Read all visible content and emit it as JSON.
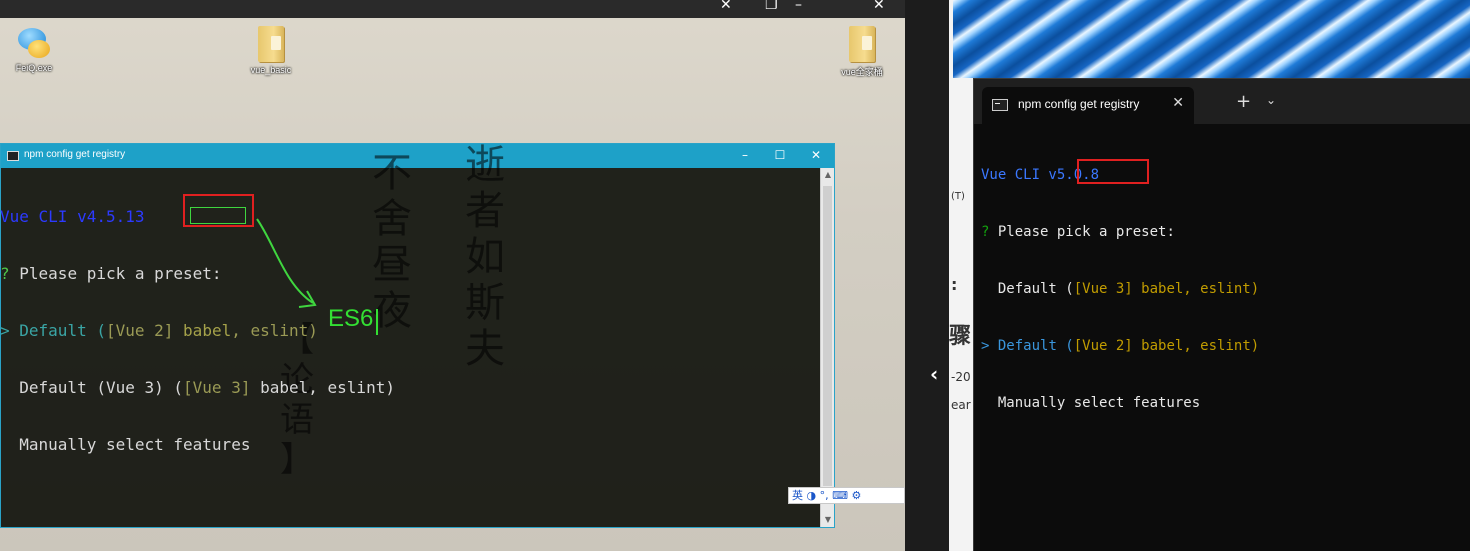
{
  "desktop": {
    "icons": [
      {
        "label": "FeiQ.exe",
        "icon": "feiq-icon"
      },
      {
        "label": "vue_basic",
        "icon": "folder-icon"
      },
      {
        "label": "vue全家桶",
        "icon": "folder-icon"
      }
    ],
    "help_label": "?"
  },
  "calligraphy": {
    "col1": [
      "不",
      "舍",
      "昼",
      "夜"
    ],
    "col2": [
      "逝",
      "者",
      "如",
      "斯",
      "夫"
    ],
    "col3": [
      "【",
      "论",
      "语",
      "】"
    ]
  },
  "old_console": {
    "title": "npm config get registry",
    "lines": {
      "l1": "Vue CLI v4.5.13",
      "l2_q": "?",
      "l2_text": " Please pick a preset:",
      "l3_arrow": ">",
      "l3_pre": " Default (",
      "l3_vue": "[Vue 2]",
      "l3_sp": " ",
      "l3_babel": "babel",
      "l3_rest": ", eslint)",
      "l4_pre": "  Default (Vue 3) (",
      "l4_vue": "[Vue 3]",
      "l4_rest": " babel, eslint)",
      "l5": "  Manually select features"
    },
    "annotation": "ES6"
  },
  "ime": {
    "label": "英 ◑ °, ⌨ ⚙"
  },
  "terminal": {
    "tab_title": "npm config get registry",
    "lines": {
      "l1": "Vue CLI v5.0.8",
      "l2_q": "?",
      "l2_text": " Please pick a preset:",
      "l3_pre": "  Default (",
      "l3_vue": "[Vue 3]",
      "l3_rest": " babel, eslint)",
      "l4_arrow": ">",
      "l4_pre": " Default (",
      "l4_vue": "[Vue 2]",
      "l4_rest": " babel, eslint)",
      "l5": "  Manually select features"
    }
  },
  "background_fragments": {
    "f1": "(T)",
    "f2": ":",
    "f3": "骤",
    "f4": "-20",
    "f5": "ear"
  }
}
